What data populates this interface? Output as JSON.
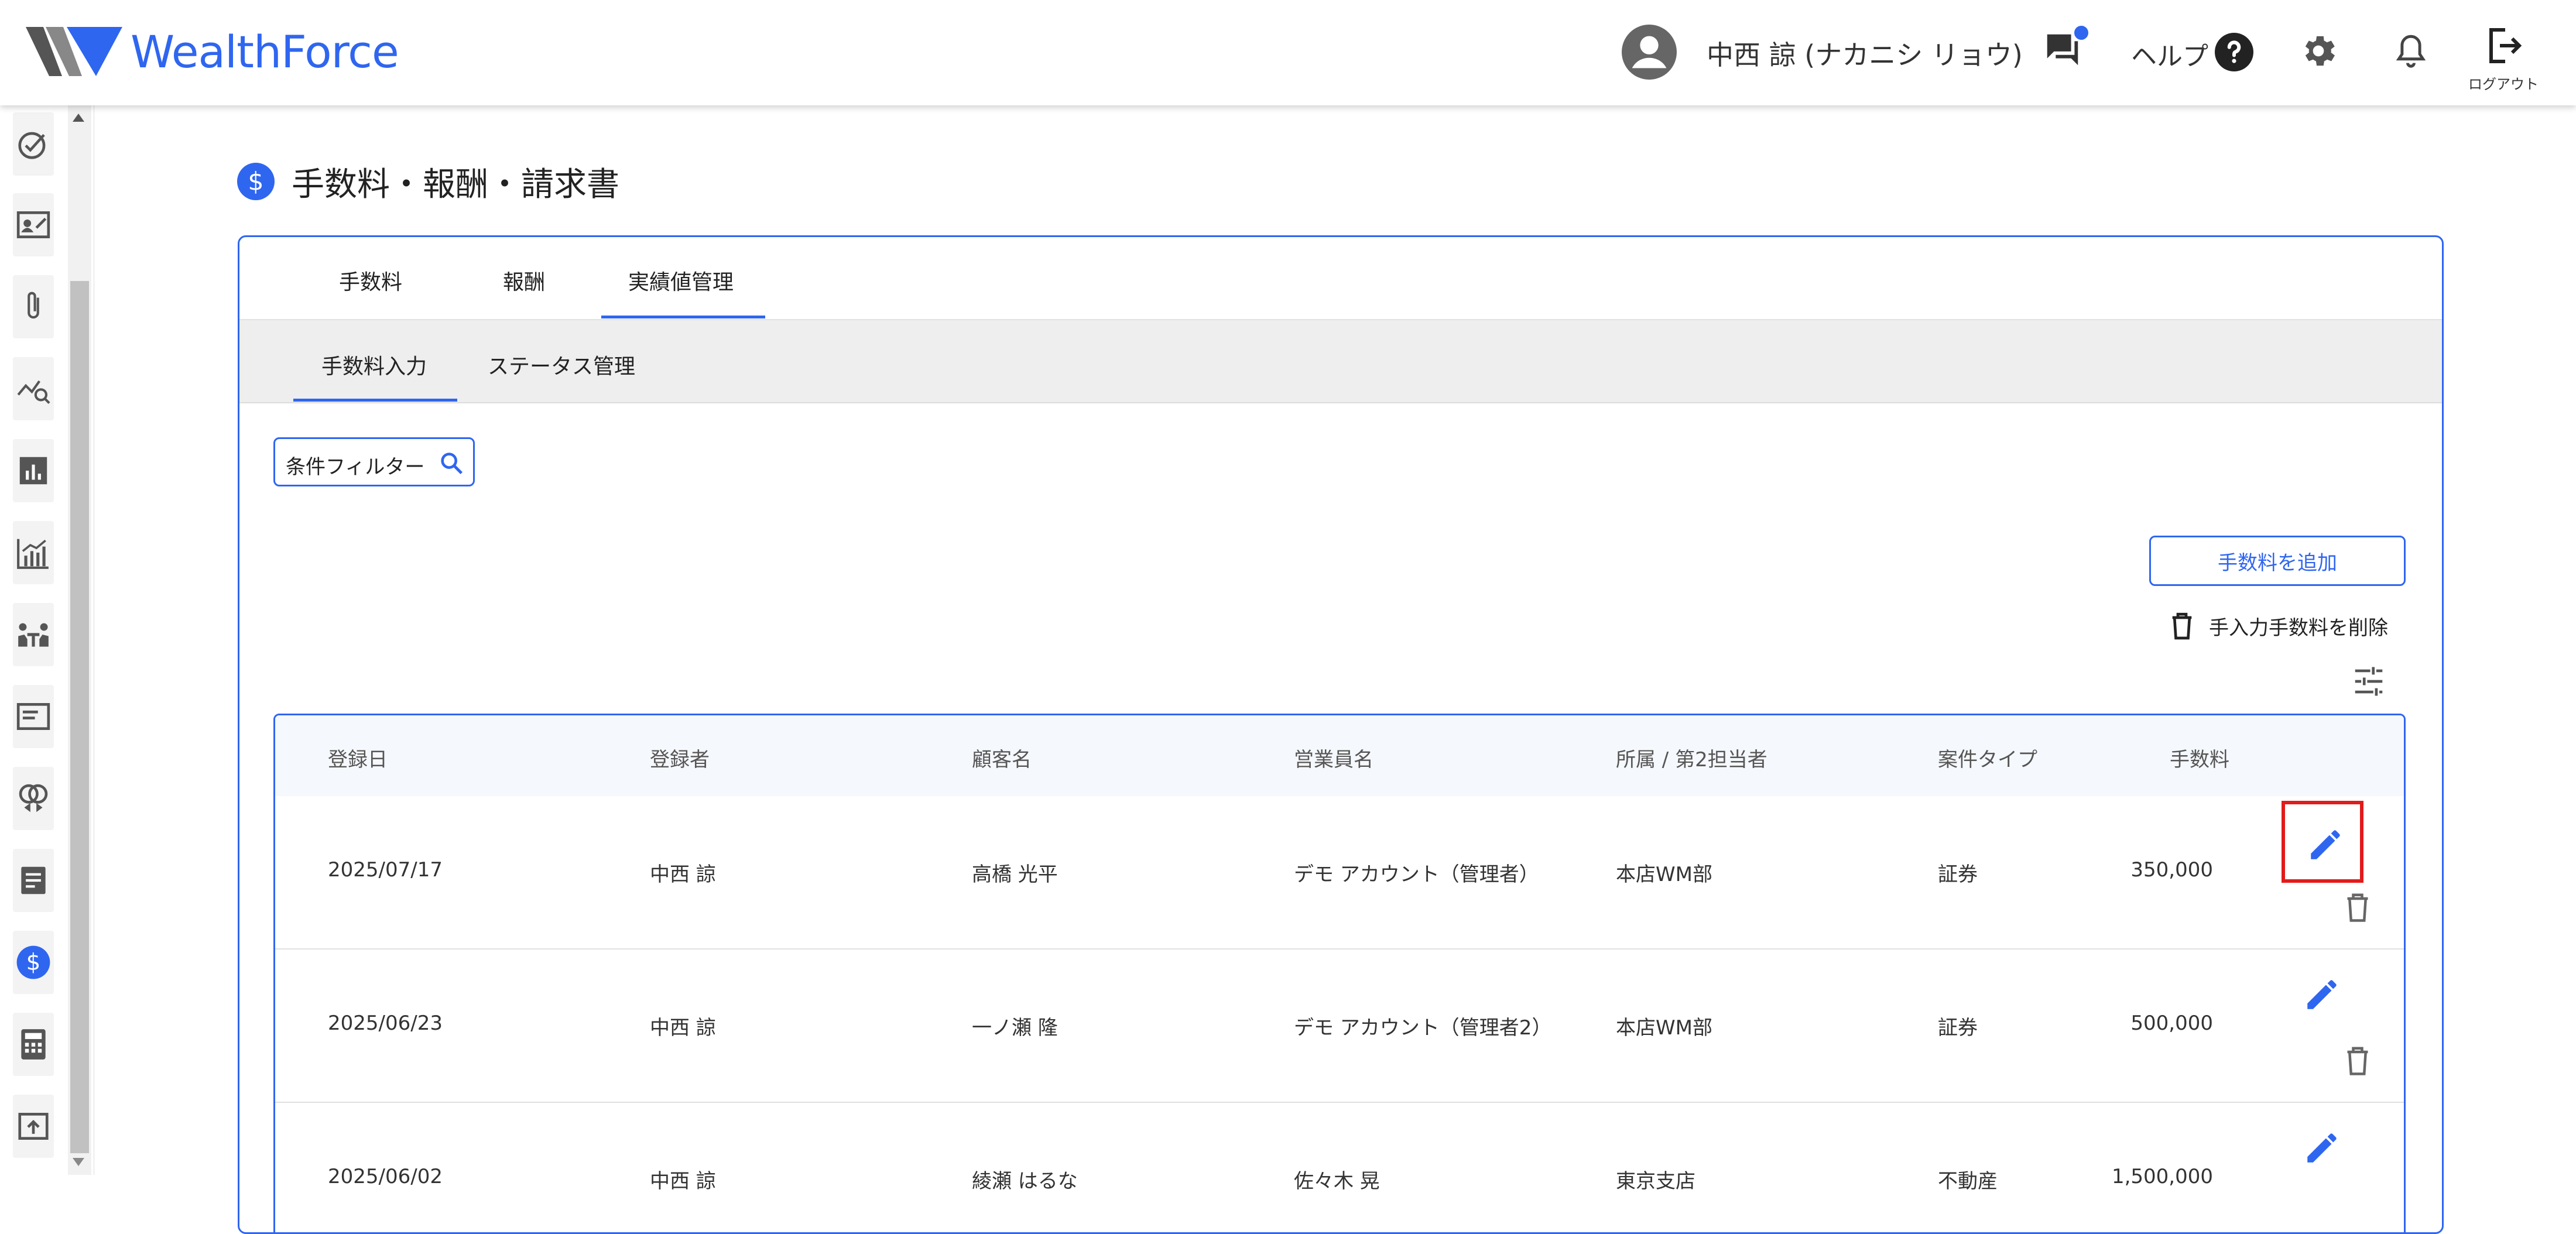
{
  "header": {
    "logo_text": "WealthForce",
    "user_name": "中西 諒 (ナカニシ リョウ)",
    "help_label": "ヘルプ",
    "logout_label": "ログアウト"
  },
  "page": {
    "title": "手数料・報酬・請求書"
  },
  "tabs": [
    {
      "label": "手数料",
      "active": false
    },
    {
      "label": "報酬",
      "active": false
    },
    {
      "label": "実績値管理",
      "active": true
    }
  ],
  "subtabs": [
    {
      "label": "手数料入力",
      "active": true
    },
    {
      "label": "ステータス管理",
      "active": false
    }
  ],
  "filter": {
    "label": "条件フィルター"
  },
  "actions": {
    "add_fee": "手数料を追加",
    "delete_manual_fee": "手入力手数料を削除"
  },
  "table": {
    "columns": [
      "登録日",
      "登録者",
      "顧客名",
      "営業員名",
      "所属 / 第2担当者",
      "案件タイプ",
      "手数料"
    ],
    "rows": [
      [
        "2025/07/17",
        "中西 諒",
        "高橋 光平",
        "デモ アカウント（管理者）",
        "本店WM部",
        "証券",
        "350,000"
      ],
      [
        "2025/06/23",
        "中西 諒",
        "一ノ瀬 隆",
        "デモ アカウント（管理者2）",
        "本店WM部",
        "証券",
        "500,000"
      ],
      [
        "2025/06/02",
        "中西 諒",
        "綾瀬 はるな",
        "佐々木 晃",
        "東京支店",
        "不動産",
        "1,500,000"
      ]
    ]
  },
  "colors": {
    "accent": "#2f66f0",
    "highlight": "#e21b1b"
  }
}
